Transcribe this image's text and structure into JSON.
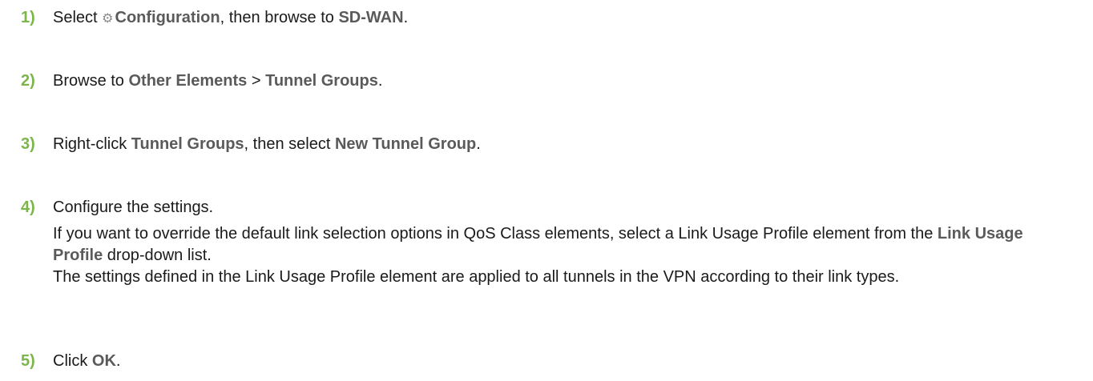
{
  "steps": [
    {
      "num": "1)",
      "parts": {
        "t1": "Select ",
        "icon": "gear-icon",
        "ui1": "Configuration",
        "t2": ", then browse to ",
        "ui2": "SD-WAN",
        "t3": "."
      }
    },
    {
      "num": "2)",
      "parts": {
        "t1": "Browse to ",
        "ui1": "Other Elements",
        "t2": " > ",
        "ui2": "Tunnel Groups",
        "t3": "."
      }
    },
    {
      "num": "3)",
      "parts": {
        "t1": "Right-click ",
        "ui1": "Tunnel Groups",
        "t2": ", then select ",
        "ui2": "New Tunnel Group",
        "t3": "."
      }
    },
    {
      "num": "4)",
      "parts": {
        "t1": "Configure the settings.",
        "p2a": "If you want to override the default link selection options in QoS Class elements, select a Link Usage Profile element from the ",
        "ui1": "Link Usage Profile",
        "p2b": " drop-down list.",
        "p3": "The settings defined in the Link Usage Profile element are applied to all tunnels in the VPN according to their link types."
      }
    },
    {
      "num": "5)",
      "parts": {
        "t1": "Click ",
        "ui1": "OK",
        "t2": "."
      }
    }
  ]
}
